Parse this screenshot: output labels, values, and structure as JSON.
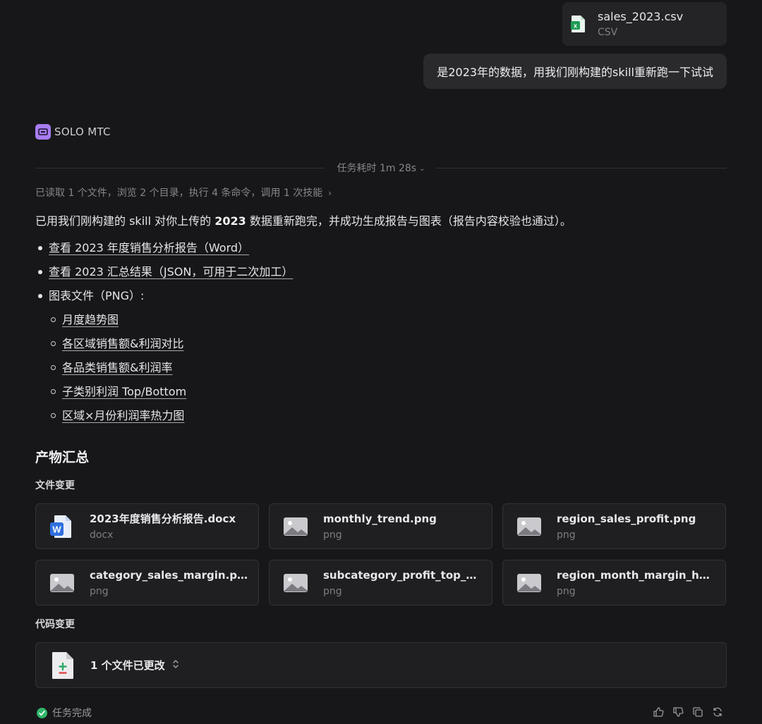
{
  "attachment": {
    "name": "sales_2023.csv",
    "type": "CSV",
    "icon": "excel-file-icon",
    "accent": "#1f9d55"
  },
  "user_message": "是2023年的数据，用我们刚构建的skill重新跑一下试试",
  "agent": {
    "name": "SOLO MTC",
    "icon": "agent-icon",
    "accent": "#a77cf0"
  },
  "task_time_label": "任务耗时 1m 28s",
  "actions_summary": "已读取 1 个文件，浏览 2 个目录，执行 4 条命令，调用 1 次技能",
  "intro": {
    "part1": "已用我们刚构建的 skill 对你上传的 ",
    "bold": "2023",
    "part2": " 数据重新跑完，并成功生成报告与图表（报告内容校验也通过）。"
  },
  "links": {
    "report": "查看 2023 年度销售分析报告（Word）",
    "summary": "查看 2023 汇总结果（JSON，可用于二次加工）",
    "charts_label": "图表文件（PNG）:",
    "charts": [
      "月度趋势图",
      "各区域销售额&利润对比",
      "各品类销售额&利润率",
      "子类别利润 Top/Bottom",
      "区域×月份利润率热力图"
    ]
  },
  "products": {
    "title": "产物汇总",
    "files_heading": "文件变更",
    "files": [
      {
        "name": "2023年度销售分析报告.docx",
        "type": "docx",
        "icon": "word-file-icon"
      },
      {
        "name": "monthly_trend.png",
        "type": "png",
        "icon": "image-file-icon"
      },
      {
        "name": "region_sales_profit.png",
        "type": "png",
        "icon": "image-file-icon"
      },
      {
        "name": "category_sales_margin.png",
        "type": "png",
        "icon": "image-file-icon"
      },
      {
        "name": "subcategory_profit_top_bo...",
        "type": "png",
        "icon": "image-file-icon"
      },
      {
        "name": "region_month_margin_heat...",
        "type": "png",
        "icon": "image-file-icon"
      }
    ],
    "code_heading": "代码变更",
    "code_changes": "1 个文件已更改"
  },
  "status": {
    "label": "任务完成",
    "color": "#2fb56a"
  },
  "footer_actions": [
    "thumbs-up-icon",
    "thumbs-down-icon",
    "copy-icon",
    "regenerate-icon"
  ]
}
